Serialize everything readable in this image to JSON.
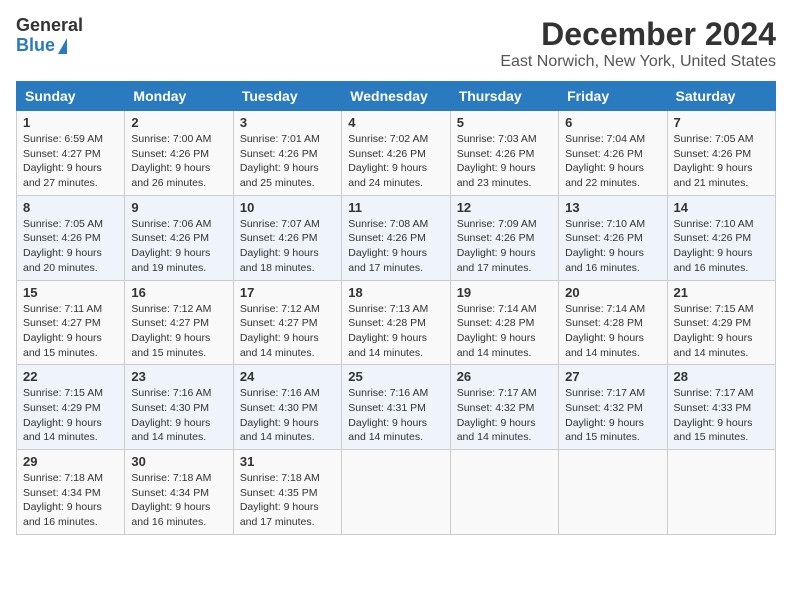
{
  "header": {
    "logo_general": "General",
    "logo_blue": "Blue",
    "title": "December 2024",
    "subtitle": "East Norwich, New York, United States"
  },
  "calendar": {
    "days_of_week": [
      "Sunday",
      "Monday",
      "Tuesday",
      "Wednesday",
      "Thursday",
      "Friday",
      "Saturday"
    ],
    "weeks": [
      [
        {
          "day": "1",
          "sunrise": "Sunrise: 6:59 AM",
          "sunset": "Sunset: 4:27 PM",
          "daylight": "Daylight: 9 hours and 27 minutes."
        },
        {
          "day": "2",
          "sunrise": "Sunrise: 7:00 AM",
          "sunset": "Sunset: 4:26 PM",
          "daylight": "Daylight: 9 hours and 26 minutes."
        },
        {
          "day": "3",
          "sunrise": "Sunrise: 7:01 AM",
          "sunset": "Sunset: 4:26 PM",
          "daylight": "Daylight: 9 hours and 25 minutes."
        },
        {
          "day": "4",
          "sunrise": "Sunrise: 7:02 AM",
          "sunset": "Sunset: 4:26 PM",
          "daylight": "Daylight: 9 hours and 24 minutes."
        },
        {
          "day": "5",
          "sunrise": "Sunrise: 7:03 AM",
          "sunset": "Sunset: 4:26 PM",
          "daylight": "Daylight: 9 hours and 23 minutes."
        },
        {
          "day": "6",
          "sunrise": "Sunrise: 7:04 AM",
          "sunset": "Sunset: 4:26 PM",
          "daylight": "Daylight: 9 hours and 22 minutes."
        },
        {
          "day": "7",
          "sunrise": "Sunrise: 7:05 AM",
          "sunset": "Sunset: 4:26 PM",
          "daylight": "Daylight: 9 hours and 21 minutes."
        }
      ],
      [
        {
          "day": "8",
          "sunrise": "Sunrise: 7:05 AM",
          "sunset": "Sunset: 4:26 PM",
          "daylight": "Daylight: 9 hours and 20 minutes."
        },
        {
          "day": "9",
          "sunrise": "Sunrise: 7:06 AM",
          "sunset": "Sunset: 4:26 PM",
          "daylight": "Daylight: 9 hours and 19 minutes."
        },
        {
          "day": "10",
          "sunrise": "Sunrise: 7:07 AM",
          "sunset": "Sunset: 4:26 PM",
          "daylight": "Daylight: 9 hours and 18 minutes."
        },
        {
          "day": "11",
          "sunrise": "Sunrise: 7:08 AM",
          "sunset": "Sunset: 4:26 PM",
          "daylight": "Daylight: 9 hours and 17 minutes."
        },
        {
          "day": "12",
          "sunrise": "Sunrise: 7:09 AM",
          "sunset": "Sunset: 4:26 PM",
          "daylight": "Daylight: 9 hours and 17 minutes."
        },
        {
          "day": "13",
          "sunrise": "Sunrise: 7:10 AM",
          "sunset": "Sunset: 4:26 PM",
          "daylight": "Daylight: 9 hours and 16 minutes."
        },
        {
          "day": "14",
          "sunrise": "Sunrise: 7:10 AM",
          "sunset": "Sunset: 4:26 PM",
          "daylight": "Daylight: 9 hours and 16 minutes."
        }
      ],
      [
        {
          "day": "15",
          "sunrise": "Sunrise: 7:11 AM",
          "sunset": "Sunset: 4:27 PM",
          "daylight": "Daylight: 9 hours and 15 minutes."
        },
        {
          "day": "16",
          "sunrise": "Sunrise: 7:12 AM",
          "sunset": "Sunset: 4:27 PM",
          "daylight": "Daylight: 9 hours and 15 minutes."
        },
        {
          "day": "17",
          "sunrise": "Sunrise: 7:12 AM",
          "sunset": "Sunset: 4:27 PM",
          "daylight": "Daylight: 9 hours and 14 minutes."
        },
        {
          "day": "18",
          "sunrise": "Sunrise: 7:13 AM",
          "sunset": "Sunset: 4:28 PM",
          "daylight": "Daylight: 9 hours and 14 minutes."
        },
        {
          "day": "19",
          "sunrise": "Sunrise: 7:14 AM",
          "sunset": "Sunset: 4:28 PM",
          "daylight": "Daylight: 9 hours and 14 minutes."
        },
        {
          "day": "20",
          "sunrise": "Sunrise: 7:14 AM",
          "sunset": "Sunset: 4:28 PM",
          "daylight": "Daylight: 9 hours and 14 minutes."
        },
        {
          "day": "21",
          "sunrise": "Sunrise: 7:15 AM",
          "sunset": "Sunset: 4:29 PM",
          "daylight": "Daylight: 9 hours and 14 minutes."
        }
      ],
      [
        {
          "day": "22",
          "sunrise": "Sunrise: 7:15 AM",
          "sunset": "Sunset: 4:29 PM",
          "daylight": "Daylight: 9 hours and 14 minutes."
        },
        {
          "day": "23",
          "sunrise": "Sunrise: 7:16 AM",
          "sunset": "Sunset: 4:30 PM",
          "daylight": "Daylight: 9 hours and 14 minutes."
        },
        {
          "day": "24",
          "sunrise": "Sunrise: 7:16 AM",
          "sunset": "Sunset: 4:30 PM",
          "daylight": "Daylight: 9 hours and 14 minutes."
        },
        {
          "day": "25",
          "sunrise": "Sunrise: 7:16 AM",
          "sunset": "Sunset: 4:31 PM",
          "daylight": "Daylight: 9 hours and 14 minutes."
        },
        {
          "day": "26",
          "sunrise": "Sunrise: 7:17 AM",
          "sunset": "Sunset: 4:32 PM",
          "daylight": "Daylight: 9 hours and 14 minutes."
        },
        {
          "day": "27",
          "sunrise": "Sunrise: 7:17 AM",
          "sunset": "Sunset: 4:32 PM",
          "daylight": "Daylight: 9 hours and 15 minutes."
        },
        {
          "day": "28",
          "sunrise": "Sunrise: 7:17 AM",
          "sunset": "Sunset: 4:33 PM",
          "daylight": "Daylight: 9 hours and 15 minutes."
        }
      ],
      [
        {
          "day": "29",
          "sunrise": "Sunrise: 7:18 AM",
          "sunset": "Sunset: 4:34 PM",
          "daylight": "Daylight: 9 hours and 16 minutes."
        },
        {
          "day": "30",
          "sunrise": "Sunrise: 7:18 AM",
          "sunset": "Sunset: 4:34 PM",
          "daylight": "Daylight: 9 hours and 16 minutes."
        },
        {
          "day": "31",
          "sunrise": "Sunrise: 7:18 AM",
          "sunset": "Sunset: 4:35 PM",
          "daylight": "Daylight: 9 hours and 17 minutes."
        },
        null,
        null,
        null,
        null
      ]
    ]
  }
}
